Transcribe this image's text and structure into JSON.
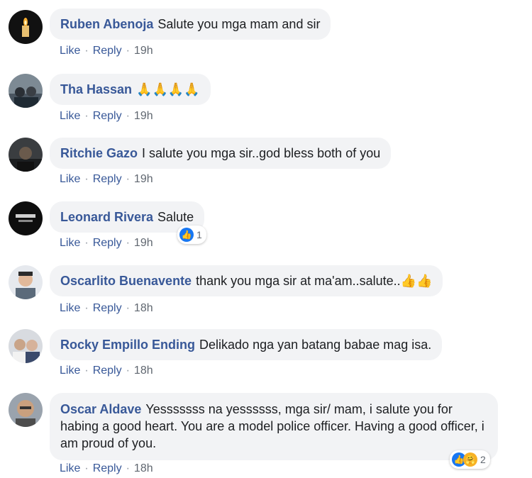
{
  "actions": {
    "like": "Like",
    "reply": "Reply",
    "sep": "·"
  },
  "comments": [
    {
      "author": "Ruben Abenoja",
      "text": "Salute you mga mam and sir",
      "time": "19h"
    },
    {
      "author": "Tha Hassan",
      "text": "🙏🙏🙏🙏",
      "time": "19h"
    },
    {
      "author": "Ritchie Gazo",
      "text": "I salute you mga sir..god bless both of you",
      "time": "19h"
    },
    {
      "author": "Leonard Rivera",
      "text": "Salute",
      "time": "19h",
      "reaction_count": "1"
    },
    {
      "author": "Oscarlito Buenavente",
      "text": "thank you mga sir at ma'am..salute..👍👍",
      "time": "18h"
    },
    {
      "author": "Rocky Empillo Ending",
      "text": "Delikado nga yan batang babae mag isa.",
      "time": "18h"
    },
    {
      "author": "Oscar Aldave",
      "text": "Yesssssss na yessssss, mga sir/ mam, i salute you for habing a good heart. You are a model police officer. Having a good officer, i am proud of you.",
      "time": "18h",
      "reaction_count": "2"
    }
  ],
  "colors": {
    "link": "#385898",
    "bubble": "#f2f3f5",
    "text": "#1c1e21",
    "meta": "#606770",
    "like": "#1877f2"
  },
  "icons": {
    "like_reaction": "thumbs-up-icon",
    "care_reaction": "care-emoji-icon"
  }
}
